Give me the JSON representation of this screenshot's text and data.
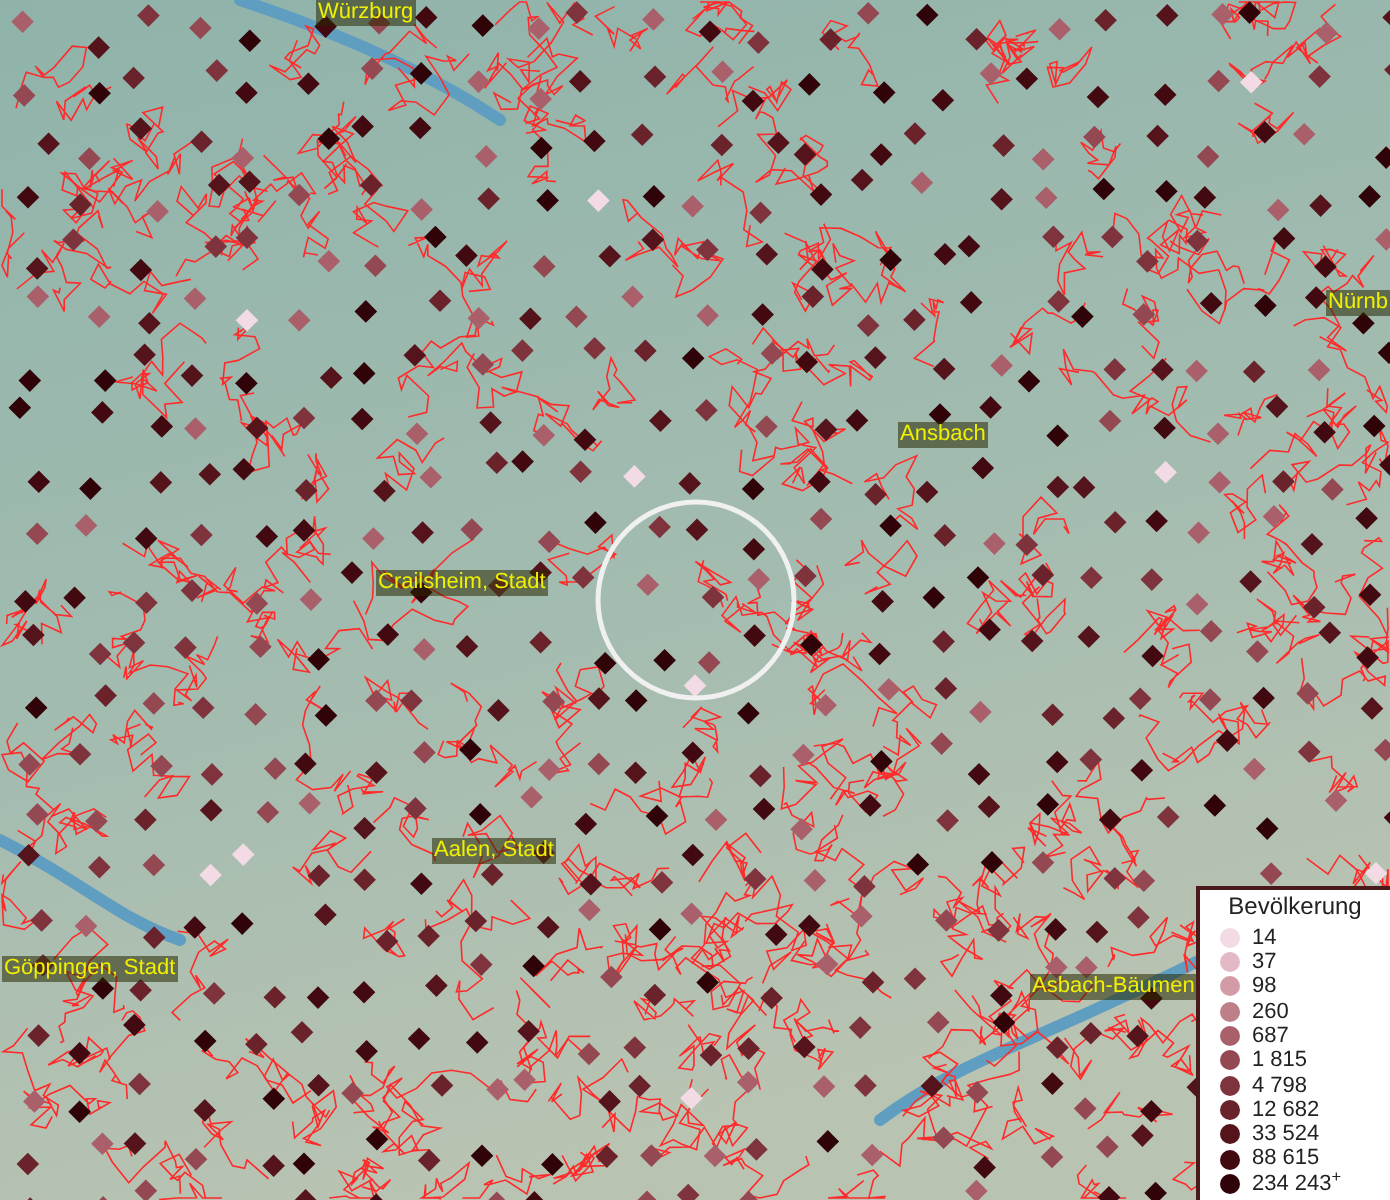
{
  "map": {
    "labels": [
      {
        "text": "Würzburg"
      },
      {
        "text": "Nürnb"
      },
      {
        "text": "Ansbach"
      },
      {
        "text": "Crailsheim, Stadt"
      },
      {
        "text": "Aalen, Stadt"
      },
      {
        "text": "Göppingen, Stadt"
      },
      {
        "text": "Asbach-Bäumen"
      }
    ]
  },
  "legend": {
    "title": "Bevölkerung",
    "items": [
      {
        "label": "14",
        "color": "#f3dbe5"
      },
      {
        "label": "37",
        "color": "#e2b9c4"
      },
      {
        "label": "98",
        "color": "#d29ba6"
      },
      {
        "label": "260",
        "color": "#bf7f88"
      },
      {
        "label": "687",
        "color": "#a9606a"
      },
      {
        "label": "1 815",
        "color": "#944851"
      },
      {
        "label": "4 798",
        "color": "#7f343d"
      },
      {
        "label": "12 682",
        "color": "#6a222b"
      },
      {
        "label": "33 524",
        "color": "#55141b"
      },
      {
        "label": "88 615",
        "color": "#420a10"
      },
      {
        "label": "234 243$^{+}$",
        "color": "#300308"
      }
    ]
  }
}
